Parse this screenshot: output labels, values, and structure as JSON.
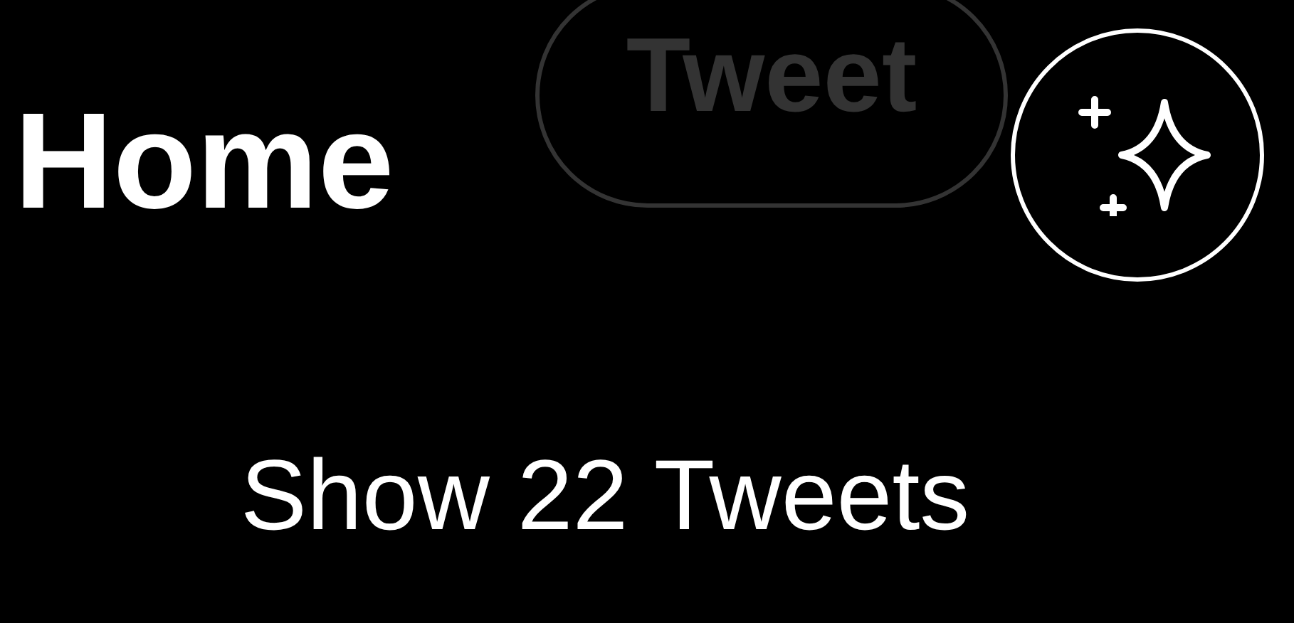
{
  "header": {
    "title": "Home",
    "tweet_button": {
      "label": "Tweet",
      "disabled": true
    }
  },
  "new_tweets": {
    "label": "Show 22 Tweets"
  }
}
